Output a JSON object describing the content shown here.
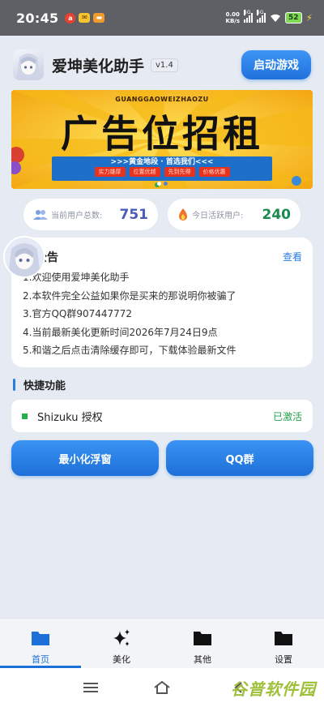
{
  "status_bar": {
    "time": "20:45",
    "net_speed_value": "0.00",
    "net_speed_unit": "KB/s",
    "signal_label": "5G",
    "battery": "52",
    "notification_icons": [
      "app-notification-icon",
      "mail-icon",
      "wallet-icon"
    ]
  },
  "header": {
    "title": "爱坤美化助手",
    "version": "v1.4",
    "launch_button": "启动游戏"
  },
  "banner": {
    "pinyin": "GUANGGAOWEIZHAOZU",
    "headline": "广告位招租",
    "slogan": ">>>黄金地段 · 首选我们<<<",
    "tags": [
      "实力雄厚",
      "位置优越",
      "先到先得",
      "价格优惠"
    ]
  },
  "stats": {
    "users_label": "当前用户总数:",
    "users_value": "751",
    "active_label": "今日活跃用户:",
    "active_value": "240"
  },
  "notice": {
    "title": "公告",
    "more": "查看",
    "items": [
      "1.欢迎使用爱坤美化助手",
      "2.本软件完全公益如果你是买来的那说明你被骗了",
      "3.官方QQ群907447772",
      "4.当前最新美化更新时间2026年7月24日9点",
      "5.和谐之后点击清除缓存即可，下载体验最新文件"
    ]
  },
  "quick": {
    "section_title": "快捷功能",
    "shizuku_label": "Shizuku 授权",
    "shizuku_status": "已激活",
    "btn_minimize": "最小化浮窗",
    "btn_qq": "QQ群"
  },
  "bottom_nav": {
    "items": [
      {
        "label": "首页",
        "icon": "folder-icon"
      },
      {
        "label": "美化",
        "icon": "sparkle-icon"
      },
      {
        "label": "其他",
        "icon": "folder-icon"
      },
      {
        "label": "设置",
        "icon": "folder-icon"
      }
    ],
    "active_index": 0
  },
  "watermark": "谷普软件园",
  "colors": {
    "accent": "#1d70d8",
    "active_green": "#22a04a",
    "banner_yellow": "#f7c81b"
  }
}
